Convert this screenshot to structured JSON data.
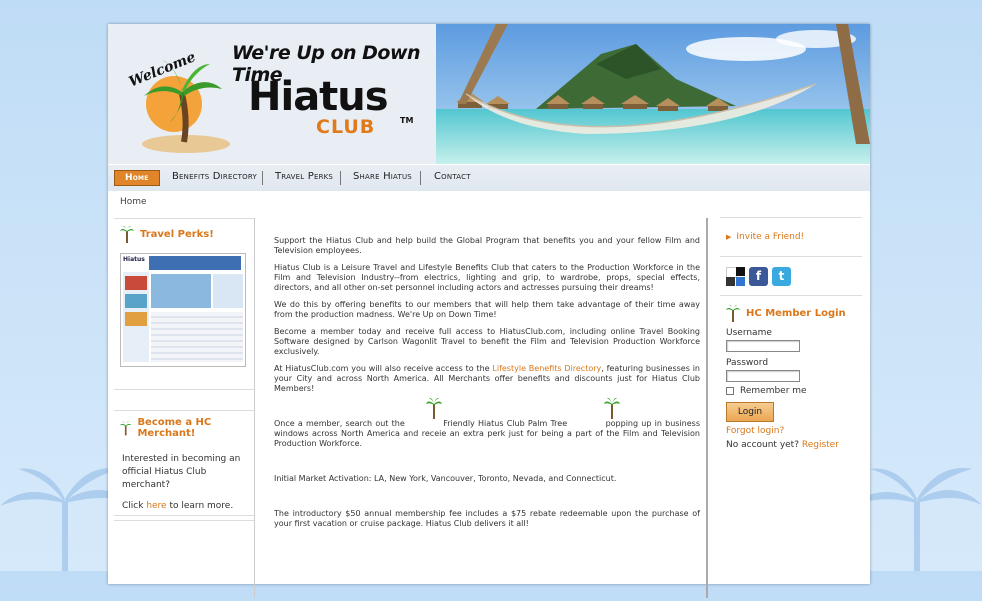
{
  "header": {
    "welcome": "Welcome",
    "tagline": "We're Up on Down Time",
    "brand": "Hiatus",
    "brand_club": "CLUB",
    "tm": "TM"
  },
  "nav": {
    "items": [
      {
        "label": "Home",
        "active": true
      },
      {
        "label": "Benefits Directory"
      },
      {
        "label": "Travel Perks"
      },
      {
        "label": "Share Hiatus"
      },
      {
        "label": "Contact"
      }
    ]
  },
  "breadcrumb": "Home",
  "left": {
    "travel_perks_title": "Travel Perks!",
    "thumb_header": "Hiatus",
    "merchant_title": "Become a HC Merchant!",
    "merchant_text": "Interested in becoming an official Hiatus Club merchant?",
    "click_prefix": "Click ",
    "click_link": "here",
    "click_suffix": " to learn more."
  },
  "main": {
    "p1": "Support the Hiatus Club and help build the Global Program that benefits you and your fellow Film and Television employees.",
    "p2": "Hiatus Club is a Leisure Travel and Lifestyle Benefits Club that caters to the Production Workforce in the Film and Television Industry--from electrics, lighting and grip, to wardrobe, props, special effects, directors, and all other on-set personnel including actors and actresses pursuing their dreams!",
    "p3": "We do this by offering benefits to our members that will help them take advantage of their time away from the production madness. We're Up on Down Time!",
    "p4": "Become a member today and receive full access to HiatusClub.com, including online Travel Booking Software designed by Carlson Wagonlit Travel to benefit the Film and Television Production Workforce exclusively.",
    "p5_pre": "At HiatusClub.com you will also receive access to the ",
    "p5_link": "Lifestyle Benefits Directory",
    "p5_post": ", featuring businesses in your City and across North America. All Merchants offer benefits and discounts just for Hiatus Club Members!",
    "p6_a": "Once a member, search out the",
    "p6_b": "Friendly Hiatus Club Palm Tree",
    "p6_c": "popping up in business windows across North America and receie an extra perk just for being a part of the Film and Television Production Workforce.",
    "p7": "Initial Market Activation: LA, New York, Vancouver, Toronto, Nevada, and Connecticut.",
    "p8": "The introductory $50 annual membership fee includes a $75 rebate redeemable upon the purchase of your first vacation or cruise package. Hiatus Club delivers it all!"
  },
  "right": {
    "invite": "Invite a Friend!",
    "social": {
      "delicious": "",
      "facebook": "f",
      "twitter": "t"
    },
    "login_title": "HC Member Login",
    "username_label": "Username",
    "password_label": "Password",
    "remember_label": "Remember me",
    "login_button": "Login",
    "forgot": "Forgot login?",
    "no_account": "No account yet? ",
    "register": "Register"
  },
  "colors": {
    "accent": "#d9771a",
    "nav_active": "#e0852a"
  }
}
